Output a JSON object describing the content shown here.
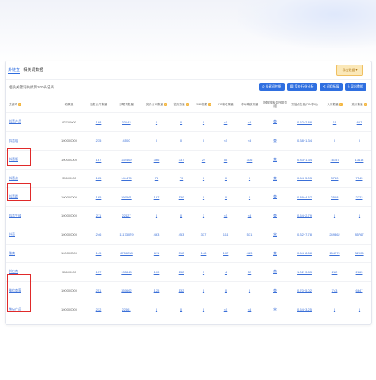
{
  "tabs": [
    {
      "label": "外链查"
    },
    {
      "label": "相关词数据"
    }
  ],
  "export_top_label": "导出数据 ▾",
  "note": "相关关键词共找到200条记录",
  "buttons": [
    {
      "label": "长尾词挖掘",
      "icon": "search-icon"
    },
    {
      "label": "竞价行业分析",
      "icon": "chart-icon"
    },
    {
      "label": "词组拓展",
      "icon": "share-icon"
    },
    {
      "label": "导出数据",
      "icon": "download-icon"
    }
  ],
  "headers": [
    "关键词",
    "收录量",
    "指数公开数量",
    "长尾词数量",
    "竞价公司数量",
    "首页数量",
    "2020指数",
    "PC端收录量",
    "移动端收录量",
    "指数/搜索量所带词组",
    "预估点击量(PC/移动)",
    "头条数量",
    "竞价数量"
  ],
  "rows": [
    {
      "kw": "抖音产品",
      "v": [
        "92700000",
        "168",
        "33642",
        "0",
        "0",
        "0",
        "<5",
        "<5",
        "查",
        "0.52~2.88",
        "12",
        "667"
      ]
    },
    {
      "kw": "抖音机",
      "v": [
        "100000000",
        "235",
        "4500",
        "0",
        "0",
        "0",
        "<5",
        "<5",
        "查",
        "0.38~1.34",
        "0",
        "0"
      ]
    },
    {
      "kw": "抖音版",
      "v": [
        "100000000",
        "167",
        "334469",
        "366",
        "337",
        "27",
        "58",
        "336",
        "查",
        "0.83~1.34",
        "16157",
        "13113"
      ]
    },
    {
      "kw": "抖音点",
      "v": [
        "39600000",
        "165",
        "144475",
        "75",
        "79",
        "0",
        "0",
        "0",
        "查",
        "0.54~5.03",
        "3750",
        "7545"
      ]
    },
    {
      "kw": "抖音群",
      "v": [
        "100000000",
        "165",
        "290561",
        "197",
        "130",
        "0",
        "0",
        "0",
        "查",
        "0.89~4.67",
        "2568",
        "2222"
      ]
    },
    {
      "kw": "抖音生成",
      "v": [
        "100000000",
        "211",
        "22427",
        "0",
        "0",
        "1",
        "<5",
        "<5",
        "查",
        "0.54~2.79",
        "0",
        "0"
      ]
    },
    {
      "kw": "抖音",
      "v": [
        "100000000",
        "246",
        "11173079",
        "463",
        "453",
        "337",
        "114",
        "531",
        "查",
        "0.32~7.78",
        "249862",
        "85767"
      ]
    },
    {
      "kw": "微商",
      "v": [
        "100000000",
        "145",
        "6758258",
        "611",
        "512",
        "148",
        "107",
        "423",
        "查",
        "0.54~8.58",
        "154279",
        "32006"
      ]
    },
    {
      "kw": "抖店商",
      "v": [
        "55600000",
        "137",
        "135848",
        "100",
        "132",
        "3",
        "4",
        "52",
        "查",
        "1.02~3.83",
        "282",
        "2665"
      ]
    },
    {
      "kw": "微信商家",
      "v": [
        "100000000",
        "251",
        "350662",
        "125",
        "132",
        "0",
        "0",
        "0",
        "查",
        "0.70~5.02",
        "743",
        "6847"
      ]
    },
    {
      "kw": "微店产品",
      "v": [
        "100000000",
        "212",
        "22461",
        "0",
        "0",
        "0",
        "<5",
        "<5",
        "查",
        "0.54~3.25",
        "0",
        "0"
      ]
    },
    {
      "kw": "抖音推广",
      "v": [
        "67300000",
        "158",
        "673654",
        "295",
        "255",
        "12",
        "33",
        "150",
        "查",
        "0.59~3.83",
        "1695",
        "8911"
      ]
    }
  ]
}
